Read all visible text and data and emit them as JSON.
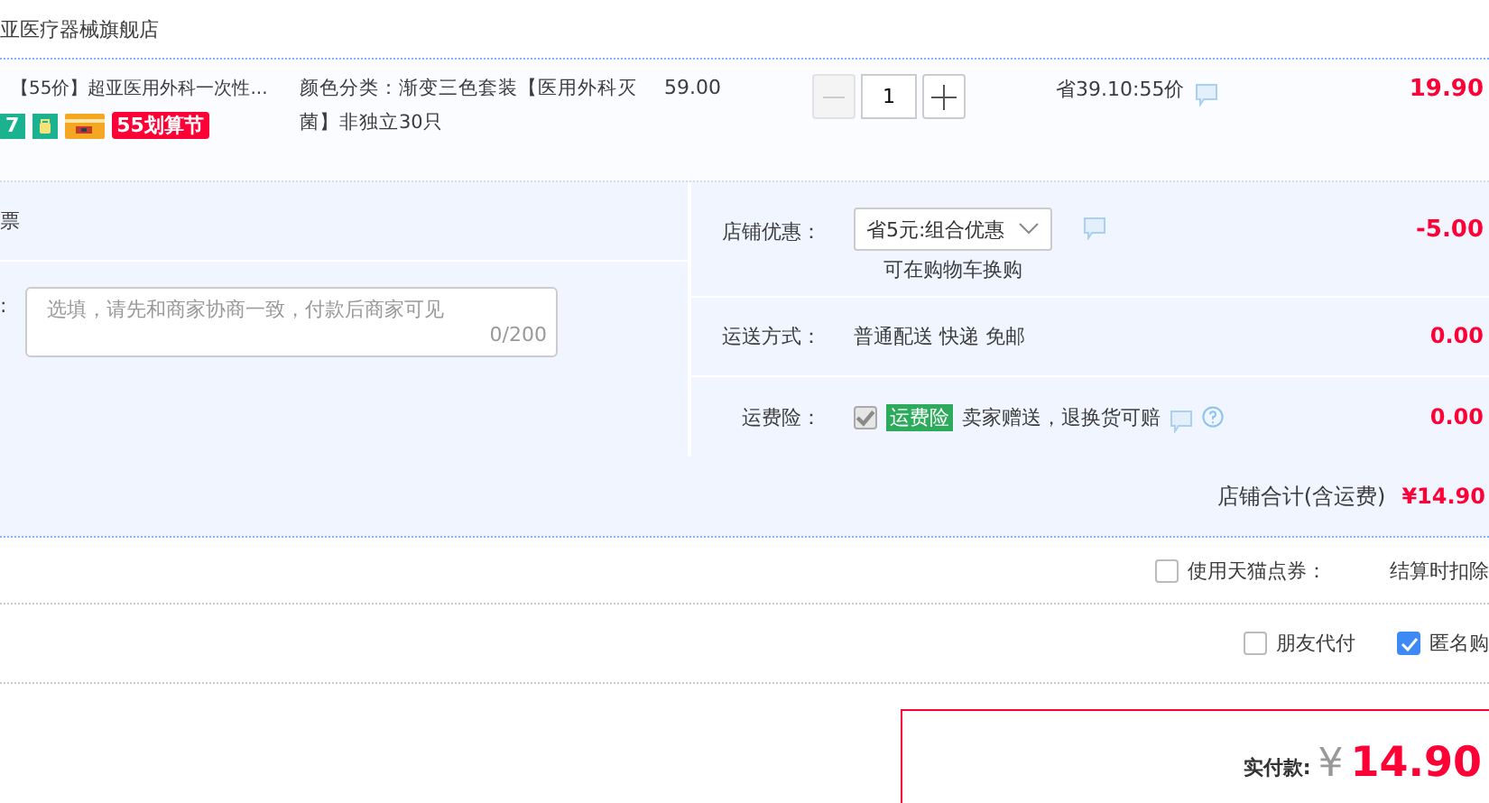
{
  "shop": {
    "name": "亚医疗器械旗舰店"
  },
  "item": {
    "title": "【55价】超亚医用外科一次性...",
    "badges": [
      {
        "kind": "number",
        "text": "7"
      },
      {
        "kind": "bag"
      },
      {
        "kind": "card"
      },
      {
        "kind": "promo",
        "text": "55划算节"
      }
    ],
    "spec": "颜色分类：渐变三色套装【医用外科灭菌】非独立30只",
    "price": "59.00",
    "quantity": {
      "value": "1",
      "minus_disabled": true
    },
    "saving": "省39.10:55价",
    "subtotal": "19.90"
  },
  "invoice": {
    "label": "票"
  },
  "message": {
    "label": ":",
    "placeholder": "选填，请先和商家协商一致，付款后商家可见",
    "counter": "0/200"
  },
  "fees": [
    {
      "kind": "coupon",
      "label": "店铺优惠：",
      "value": "省5元:组合优惠",
      "note": "可在购物车换购",
      "amount": "-5.00"
    },
    {
      "kind": "shipping",
      "label": "运送方式：",
      "value": "普通配送 快递 免邮",
      "amount": "0.00"
    },
    {
      "kind": "insurance",
      "label": "运费险：",
      "checked": true,
      "disabled": true,
      "tag": "运费险",
      "value": "卖家赠送，退换货可赔",
      "amount": "0.00"
    }
  ],
  "shop_total": {
    "label": "店铺合计(含运费)",
    "amount": "¥14.90"
  },
  "options": [
    [
      {
        "label": "使用天猫点券：",
        "checked": false,
        "note": "结算时扣除"
      }
    ],
    [
      {
        "label": "朋友代付",
        "checked": false
      },
      {
        "label": "匿名购",
        "checked": true
      }
    ]
  ],
  "payment": {
    "label": "实付款:",
    "currency": "¥",
    "amount": "14.90"
  }
}
